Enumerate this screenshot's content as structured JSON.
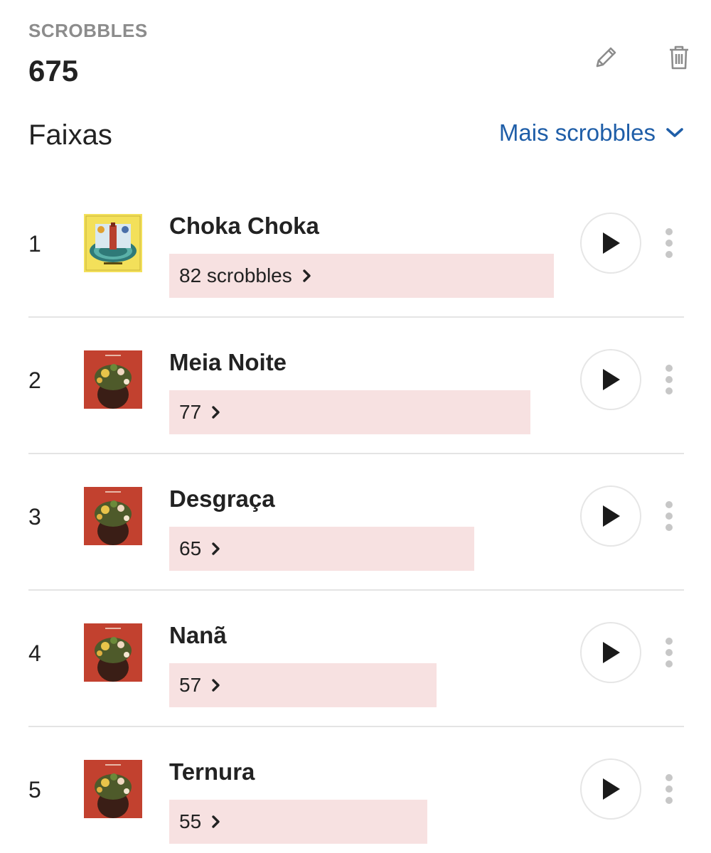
{
  "header": {
    "label": "SCROBBLES",
    "count": "675",
    "edit_icon": "pencil-icon",
    "delete_icon": "trash-icon"
  },
  "section": {
    "title": "Faixas",
    "more_label": "Mais scrobbles",
    "more_icon": "chevron-down-icon"
  },
  "colors": {
    "accent": "#1f5ea8",
    "bar": "#f7e1e1",
    "divider": "#e4e4e4"
  },
  "tracks": [
    {
      "rank": "1",
      "name": "Choka Choka",
      "scrobbles_label": "82 scrobbles",
      "scrobbles": 82,
      "cover": "choka"
    },
    {
      "rank": "2",
      "name": "Meia Noite",
      "scrobbles_label": "77",
      "scrobbles": 77,
      "cover": "red"
    },
    {
      "rank": "3",
      "name": "Desgraça",
      "scrobbles_label": "65",
      "scrobbles": 65,
      "cover": "red"
    },
    {
      "rank": "4",
      "name": "Nanã",
      "scrobbles_label": "57",
      "scrobbles": 57,
      "cover": "red"
    },
    {
      "rank": "5",
      "name": "Ternura",
      "scrobbles_label": "55",
      "scrobbles": 55,
      "cover": "red"
    }
  ]
}
